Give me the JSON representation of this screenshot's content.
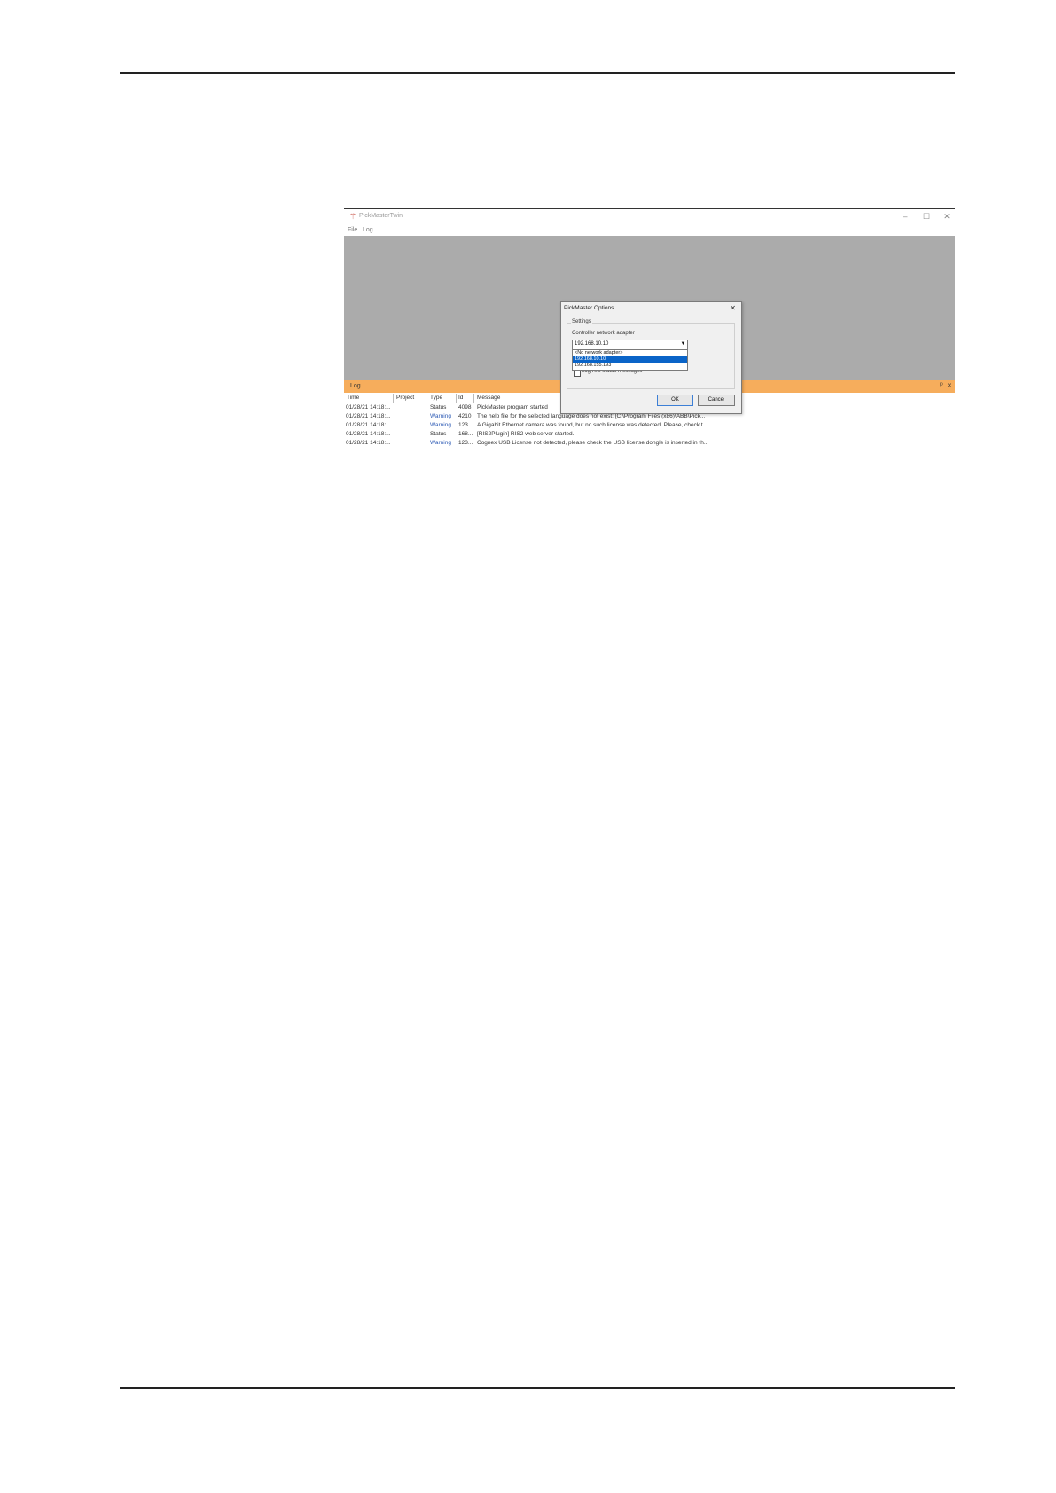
{
  "app": {
    "window_title": "PickMasterTwin",
    "window_controls": [
      "–",
      "☐",
      "✕"
    ],
    "menu": [
      "File",
      "Log"
    ]
  },
  "log": {
    "title": "Log",
    "panel_controls": [
      "ᵖ",
      "✕"
    ],
    "columns": [
      "Time",
      "Project",
      "Type",
      "Id",
      "Message"
    ],
    "rows": [
      {
        "time": "01/28/21 14:18:...",
        "project": "",
        "type": "Status",
        "id": "4098",
        "message": "PickMaster program started"
      },
      {
        "time": "01/28/21 14:18:...",
        "project": "",
        "type": "Warning",
        "id": "4210",
        "message": "The help file for the selected language does not exist: [C:\\Program Files (x86)\\ABB\\Pick..."
      },
      {
        "time": "01/28/21 14:18:...",
        "project": "",
        "type": "Warning",
        "id": "123...",
        "message": "A Gigabit Ethernet camera was found, but no such license was detected. Please, check t..."
      },
      {
        "time": "01/28/21 14:18:...",
        "project": "",
        "type": "Status",
        "id": "168...",
        "message": "[RIS2Plugin] RIS2 web server started."
      },
      {
        "time": "01/28/21 14:18:...",
        "project": "",
        "type": "Warning",
        "id": "123...",
        "message": "Cognex USB License not detected, please check the USB license dongle is inserted in th..."
      }
    ]
  },
  "dialog": {
    "title": "PickMaster Options",
    "close": "✕",
    "group_label": "Settings",
    "field_label": "Controller network adapter",
    "selected_value": "192.168.10.10",
    "options": [
      "<No network adapter>",
      "192.168.10.10",
      "192.168.155.193"
    ],
    "selected_index": 1,
    "checkbox_label": "Log RIS status messages",
    "ok_label": "OK",
    "cancel_label": "Cancel"
  }
}
